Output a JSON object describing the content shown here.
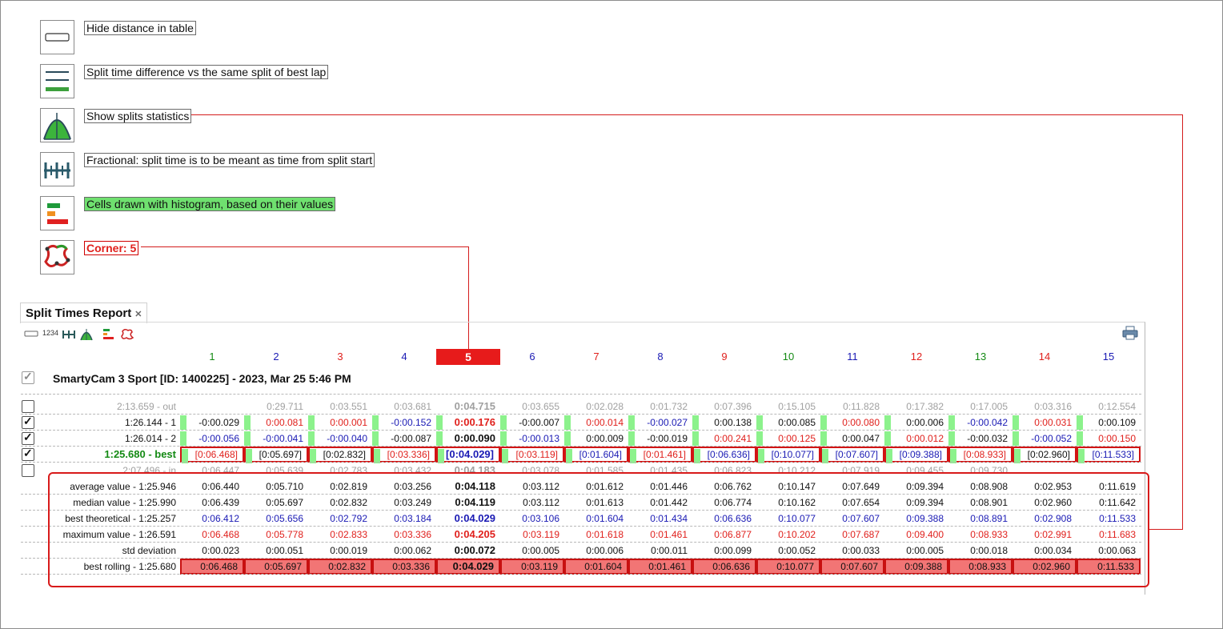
{
  "legend": [
    {
      "icon": "hide-distance-icon",
      "label": "Hide distance in table",
      "style": "plain"
    },
    {
      "icon": "split-difference-icon",
      "label": "Split time difference vs the same split of best lap",
      "style": "plain"
    },
    {
      "icon": "splits-statistics-icon",
      "label": "Show splits statistics",
      "style": "plain"
    },
    {
      "icon": "fractional-icon",
      "label": "Fractional: split time is to be meant as time from split start",
      "style": "plain"
    },
    {
      "icon": "histogram-icon",
      "label": "Cells drawn with histogram, based on their values",
      "style": "green"
    },
    {
      "icon": "corner-track-icon",
      "label": "Corner: 5",
      "style": "red"
    }
  ],
  "panel": {
    "title": "Split Times Report",
    "close": "✕",
    "toolbar_number_label": "1234",
    "session": "SmartyCam 3 Sport [ID: 1400225] - 2023, Mar 25 5:46 PM"
  },
  "colors": {
    "red": "#e0201c",
    "blue": "#1a1ab4",
    "green": "#148a14",
    "black": "#111111",
    "gray": "#a0a0a0",
    "accent": "#e71b1b"
  },
  "columns": [
    {
      "label": "1",
      "color": "green"
    },
    {
      "label": "2",
      "color": "blue"
    },
    {
      "label": "3",
      "color": "red"
    },
    {
      "label": "4",
      "color": "blue"
    },
    {
      "label": "5",
      "color": "selected"
    },
    {
      "label": "6",
      "color": "blue"
    },
    {
      "label": "7",
      "color": "red"
    },
    {
      "label": "8",
      "color": "blue"
    },
    {
      "label": "9",
      "color": "red"
    },
    {
      "label": "10",
      "color": "green"
    },
    {
      "label": "11",
      "color": "blue"
    },
    {
      "label": "12",
      "color": "red"
    },
    {
      "label": "13",
      "color": "green"
    },
    {
      "label": "14",
      "color": "red"
    },
    {
      "label": "15",
      "color": "blue"
    }
  ],
  "lap_rows": [
    {
      "label": "2:13.659 - out",
      "checked": false,
      "label_color": "gray",
      "style": "gray",
      "values": [
        "",
        "0:29.711",
        "0:03.551",
        "0:03.681",
        "0:04.715",
        "0:03.655",
        "0:02.028",
        "0:01.732",
        "0:07.396",
        "0:15.105",
        "0:11.828",
        "0:17.382",
        "0:17.005",
        "0:03.316",
        "0:12.554"
      ],
      "colors": [
        "gray",
        "gray",
        "gray",
        "gray",
        "gray",
        "gray",
        "gray",
        "gray",
        "gray",
        "gray",
        "gray",
        "gray",
        "gray",
        "gray",
        "gray"
      ]
    },
    {
      "label": "1:26.144 - 1",
      "checked": true,
      "label_color": "black",
      "style": "bar",
      "values": [
        "-0:00.029",
        "0:00.081",
        "0:00.001",
        "-0:00.152",
        "0:00.176",
        "-0:00.007",
        "0:00.014",
        "-0:00.027",
        "0:00.138",
        "0:00.085",
        "0:00.080",
        "0:00.006",
        "-0:00.042",
        "0:00.031",
        "0:00.109"
      ],
      "colors": [
        "black",
        "red",
        "red",
        "blue",
        "red",
        "black",
        "red",
        "blue",
        "black",
        "black",
        "red",
        "black",
        "blue",
        "red",
        "black"
      ]
    },
    {
      "label": "1:26.014 - 2",
      "checked": true,
      "label_color": "black",
      "style": "bar",
      "values": [
        "-0:00.056",
        "-0:00.041",
        "-0:00.040",
        "-0:00.087",
        "0:00.090",
        "-0:00.013",
        "0:00.009",
        "-0:00.019",
        "0:00.241",
        "0:00.125",
        "0:00.047",
        "0:00.012",
        "-0:00.032",
        "-0:00.052",
        "0:00.150"
      ],
      "colors": [
        "blue",
        "blue",
        "blue",
        "black",
        "black",
        "blue",
        "black",
        "black",
        "red",
        "red",
        "black",
        "red",
        "black",
        "blue",
        "red"
      ]
    },
    {
      "label": "1:25.680 - best",
      "checked": true,
      "label_color": "green",
      "style": "boxed",
      "values": [
        "[0:06.468]",
        "[0:05.697]",
        "[0:02.832]",
        "[0:03.336]",
        "[0:04.029]",
        "[0:03.119]",
        "[0:01.604]",
        "[0:01.461]",
        "[0:06.636]",
        "[0:10.077]",
        "[0:07.607]",
        "[0:09.388]",
        "[0:08.933]",
        "[0:02.960]",
        "[0:11.533]"
      ],
      "colors": [
        "red",
        "black",
        "black",
        "red",
        "blue",
        "red",
        "blue",
        "red",
        "blue",
        "blue",
        "blue",
        "blue",
        "red",
        "black",
        "blue"
      ]
    },
    {
      "label": "2:07.496 - in",
      "checked": false,
      "label_color": "gray",
      "style": "gray",
      "values": [
        "0:06.447",
        "0:05.639",
        "0:02.783",
        "0:03.432",
        "0:04.183",
        "0:03.078",
        "0:01.585",
        "0:01.435",
        "0:06.823",
        "0:10.212",
        "0:07.919",
        "0:09.455",
        "0:09.730",
        "",
        ""
      ],
      "colors": [
        "gray",
        "gray",
        "gray",
        "gray",
        "gray",
        "gray",
        "gray",
        "gray",
        "gray",
        "gray",
        "gray",
        "gray",
        "gray",
        "gray",
        "gray"
      ]
    }
  ],
  "stat_rows": [
    {
      "label": "average value - 1:25.946",
      "style": "plain",
      "values": [
        "0:06.440",
        "0:05.710",
        "0:02.819",
        "0:03.256",
        "0:04.118",
        "0:03.112",
        "0:01.612",
        "0:01.446",
        "0:06.762",
        "0:10.147",
        "0:07.649",
        "0:09.394",
        "0:08.908",
        "0:02.953",
        "0:11.619"
      ],
      "color": "black"
    },
    {
      "label": "median value - 1:25.990",
      "style": "plain",
      "values": [
        "0:06.439",
        "0:05.697",
        "0:02.832",
        "0:03.249",
        "0:04.119",
        "0:03.112",
        "0:01.613",
        "0:01.442",
        "0:06.774",
        "0:10.162",
        "0:07.654",
        "0:09.394",
        "0:08.901",
        "0:02.960",
        "0:11.642"
      ],
      "color": "black"
    },
    {
      "label": "best theoretical - 1:25.257",
      "style": "plain",
      "values": [
        "0:06.412",
        "0:05.656",
        "0:02.792",
        "0:03.184",
        "0:04.029",
        "0:03.106",
        "0:01.604",
        "0:01.434",
        "0:06.636",
        "0:10.077",
        "0:07.607",
        "0:09.388",
        "0:08.891",
        "0:02.908",
        "0:11.533"
      ],
      "color": "blue"
    },
    {
      "label": "maximum value - 1:26.591",
      "style": "plain",
      "values": [
        "0:06.468",
        "0:05.778",
        "0:02.833",
        "0:03.336",
        "0:04.205",
        "0:03.119",
        "0:01.618",
        "0:01.461",
        "0:06.877",
        "0:10.202",
        "0:07.687",
        "0:09.400",
        "0:08.933",
        "0:02.991",
        "0:11.683"
      ],
      "color": "red"
    },
    {
      "label": "std deviation",
      "style": "plain",
      "values": [
        "0:00.023",
        "0:00.051",
        "0:00.019",
        "0:00.062",
        "0:00.072",
        "0:00.005",
        "0:00.006",
        "0:00.011",
        "0:00.099",
        "0:00.052",
        "0:00.033",
        "0:00.005",
        "0:00.018",
        "0:00.034",
        "0:00.063"
      ],
      "color": "black"
    },
    {
      "label": "best rolling - 1:25.680",
      "style": "roll",
      "values": [
        "0:06.468",
        "0:05.697",
        "0:02.832",
        "0:03.336",
        "0:04.029",
        "0:03.119",
        "0:01.604",
        "0:01.461",
        "0:06.636",
        "0:10.077",
        "0:07.607",
        "0:09.388",
        "0:08.933",
        "0:02.960",
        "0:11.533"
      ],
      "color": "black"
    }
  ]
}
